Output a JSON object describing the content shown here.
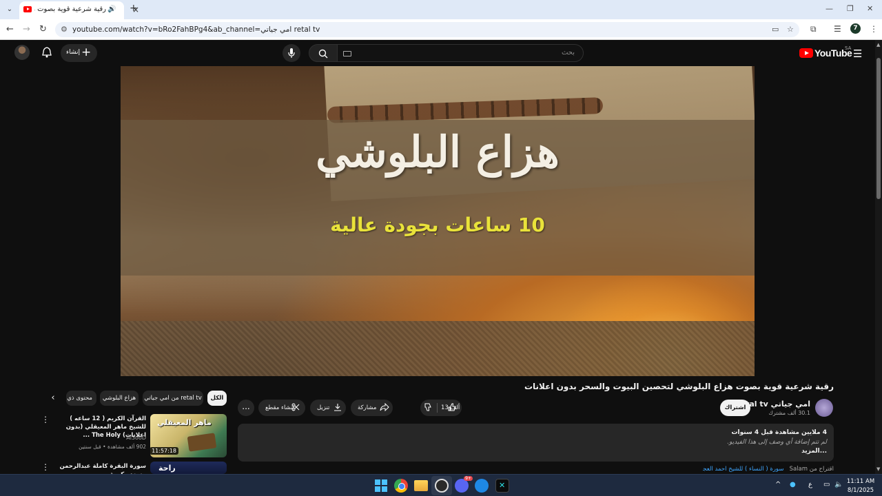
{
  "browser": {
    "tab_title": "رقية شرعية قوية بصوت هزاع",
    "url": "youtube.com/watch?v=bRo2FahBPg4&ab_channel=امي جياتي retal tv",
    "profile_initial": "7"
  },
  "header": {
    "logo_text": "YouTube",
    "country": "SA",
    "search_placeholder": "بحث",
    "create_label": "إنشاء"
  },
  "player": {
    "title_art": "هزاع البلوشي",
    "subtitle_art": "10 ساعات بجودة عالية"
  },
  "video": {
    "title": "رقية شرعية قوية بصوت هزاع البلوشي لتحصين البيوت والسحر بدون اعلانات",
    "channel_name": "امي جياتي retal tv",
    "subscribers": "30.1 ألف مشترك",
    "subscribe_label": "اشتراك",
    "likes": "13 ألف",
    "share_label": "مشاركة",
    "download_label": "تنزيل",
    "clip_label": "إنشاء مقطع",
    "more_label": "...",
    "description": {
      "meta": "4 ملايين مشاهدة قبل 4 سنوات",
      "empty_text": "لم تتم إضافة أي وصف إلى هذا الفيديو.",
      "more": "...المزيد"
    },
    "suggestion_prefix": "اقتراح من Salam",
    "suggestion_link": "سورة ( النساء ) للشيخ احمد العجمي"
  },
  "sidebar": {
    "chips": [
      {
        "label": "الكل",
        "active": true
      },
      {
        "label": "من امي جياتي retal tv",
        "active": false
      },
      {
        "label": "هزاع البلوشي",
        "active": false
      },
      {
        "label": "محتوى ذي صلة",
        "active": false
      }
    ],
    "related": [
      {
        "title": "القرآن الكريم ( 12 ساعه ) للشيخ ماهر المعيقلي (بدون اعلانات) The Holy ...",
        "channel": "Al3ooD",
        "stats": "902 ألف مشاهدة • قبل سنتين",
        "duration": "11:57:18",
        "thumb_text": "ماهر المعيقلي"
      },
      {
        "title": "سورة البقرة كاملة عبدالرحمن مسعد مكررة ...",
        "thumb_text": "راحة"
      }
    ]
  },
  "taskbar": {
    "discord_badge": "9+",
    "lang": "ع",
    "time": "11:11 AM",
    "date": "8/1/2025"
  }
}
